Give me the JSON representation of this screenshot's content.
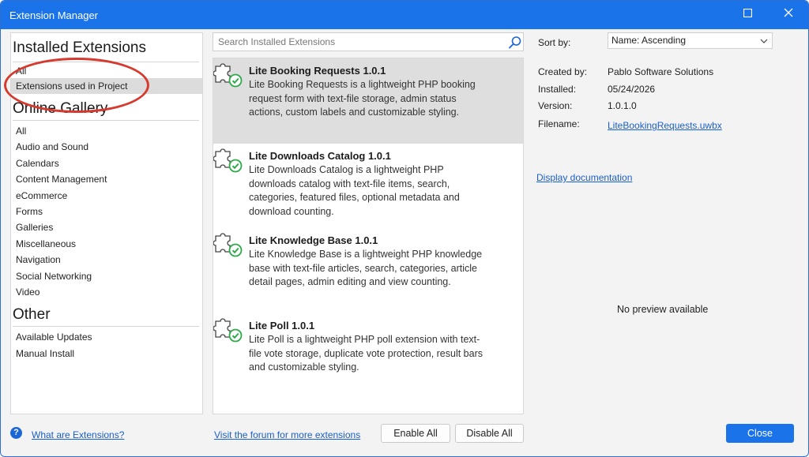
{
  "window": {
    "title": "Extension Manager"
  },
  "left_panel": {
    "installed_title": "Installed Extensions",
    "installed_items": [
      {
        "label": "All"
      },
      {
        "label": "Extensions used in Project",
        "selected": true
      }
    ],
    "gallery_title": "Online Gallery",
    "gallery_items": [
      {
        "label": "All"
      },
      {
        "label": "Audio and Sound"
      },
      {
        "label": "Calendars"
      },
      {
        "label": "Content Management"
      },
      {
        "label": "eCommerce"
      },
      {
        "label": "Forms"
      },
      {
        "label": "Galleries"
      },
      {
        "label": "Miscellaneous"
      },
      {
        "label": "Navigation"
      },
      {
        "label": "Social Networking"
      },
      {
        "label": "Video"
      }
    ],
    "other_title": "Other",
    "other_items": [
      {
        "label": "Available Updates"
      },
      {
        "label": "Manual Install"
      }
    ]
  },
  "search": {
    "placeholder": "Search Installed Extensions",
    "value": ""
  },
  "extensions": [
    {
      "name": "Lite Booking Requests 1.0.1",
      "description": "Lite Booking Requests is a lightweight PHP booking request form with text-file storage, admin status actions, custom labels and customizable styling.",
      "selected": true
    },
    {
      "name": "Lite Downloads Catalog 1.0.1",
      "description": "Lite Downloads Catalog is a lightweight PHP downloads catalog with text-file items, search, categories, featured files, optional metadata and download counting.",
      "selected": false
    },
    {
      "name": "Lite Knowledge Base 1.0.1",
      "description": "Lite Knowledge Base is a lightweight PHP knowledge base with text-file articles, search, categories, article detail pages, admin editing and view counting.",
      "selected": false
    },
    {
      "name": "Lite Poll 1.0.1",
      "description": "Lite Poll is a lightweight PHP poll extension with text-file vote storage, duplicate vote protection, result bars and customizable styling.",
      "selected": false
    }
  ],
  "details": {
    "sort_label": "Sort by:",
    "sort_value": "Name: Ascending",
    "created_by_label": "Created by:",
    "created_by_value": "Pablo Software Solutions",
    "installed_label": "Installed:",
    "installed_value": "05/24/2026",
    "version_label": "Version:",
    "version_value": "1.0.1.0",
    "filename_label": "Filename:",
    "filename_value": "LiteBookingRequests.uwbx",
    "doc_link": "Display documentation",
    "no_preview": "No preview available"
  },
  "footer": {
    "help_link": "What are Extensions?",
    "forum_link": "Visit the forum for more extensions",
    "enable_all": "Enable All",
    "disable_all": "Disable All",
    "close": "Close"
  },
  "colors": {
    "accent": "#1a73e8",
    "selection": "#dedede",
    "annotation": "#d63a2e",
    "check_green": "#2eaa4a"
  },
  "icons": {
    "title_maximize": "maximize-icon",
    "title_close": "close-icon",
    "search": "search-icon",
    "extension": "puzzle-check-icon",
    "help": "question-icon",
    "dropdown": "chevron-down-icon"
  }
}
